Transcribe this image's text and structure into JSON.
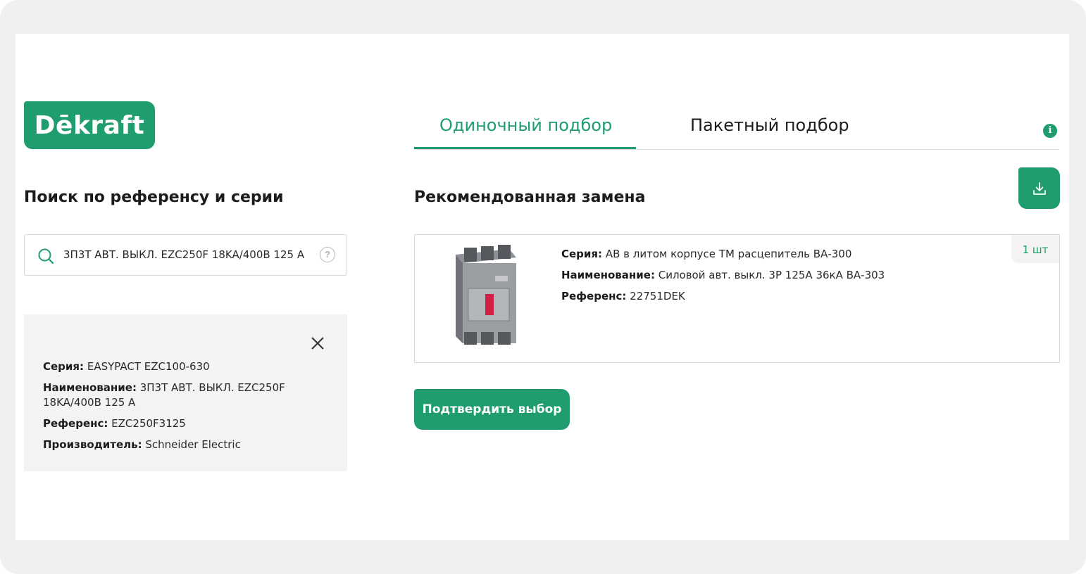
{
  "brand": {
    "logo_text": "Dēkraft",
    "accent_color": "#1f9d6f"
  },
  "left": {
    "title": "Поиск по референсу и серии",
    "search": {
      "value": "3П3Т АВТ. ВЫКЛ. EZC250F 18KA/400В 125 А",
      "help_icon": "?"
    },
    "source": {
      "series_label": "Серия:",
      "series_value": "EASYPACT EZC100-630",
      "name_label": "Наименование:",
      "name_value": "3П3Т АВТ. ВЫКЛ. EZC250F 18KA/400В 125 А",
      "ref_label": "Референс:",
      "ref_value": "EZC250F3125",
      "maker_label": "Производитель:",
      "maker_value": "Schneider Electric"
    }
  },
  "tabs": [
    {
      "label": "Одиночный подбор",
      "active": true
    },
    {
      "label": "Пакетный подбор",
      "active": false
    }
  ],
  "info_icon": "i",
  "right": {
    "title": "Рекомендованная замена",
    "product": {
      "quantity": "1 шт",
      "series_label": "Серия:",
      "series_value": "АВ в литом корпусе ТМ расцепитель ВА-300",
      "name_label": "Наименование:",
      "name_value": "Силовой авт. выкл. 3Р 125А 36кА ВА-303",
      "ref_label": "Референс:",
      "ref_value": "22751DEK"
    },
    "confirm_label": "Подтвердить выбор"
  },
  "icons": [
    "search-icon",
    "help-icon",
    "close-icon",
    "info-icon",
    "download-icon"
  ]
}
